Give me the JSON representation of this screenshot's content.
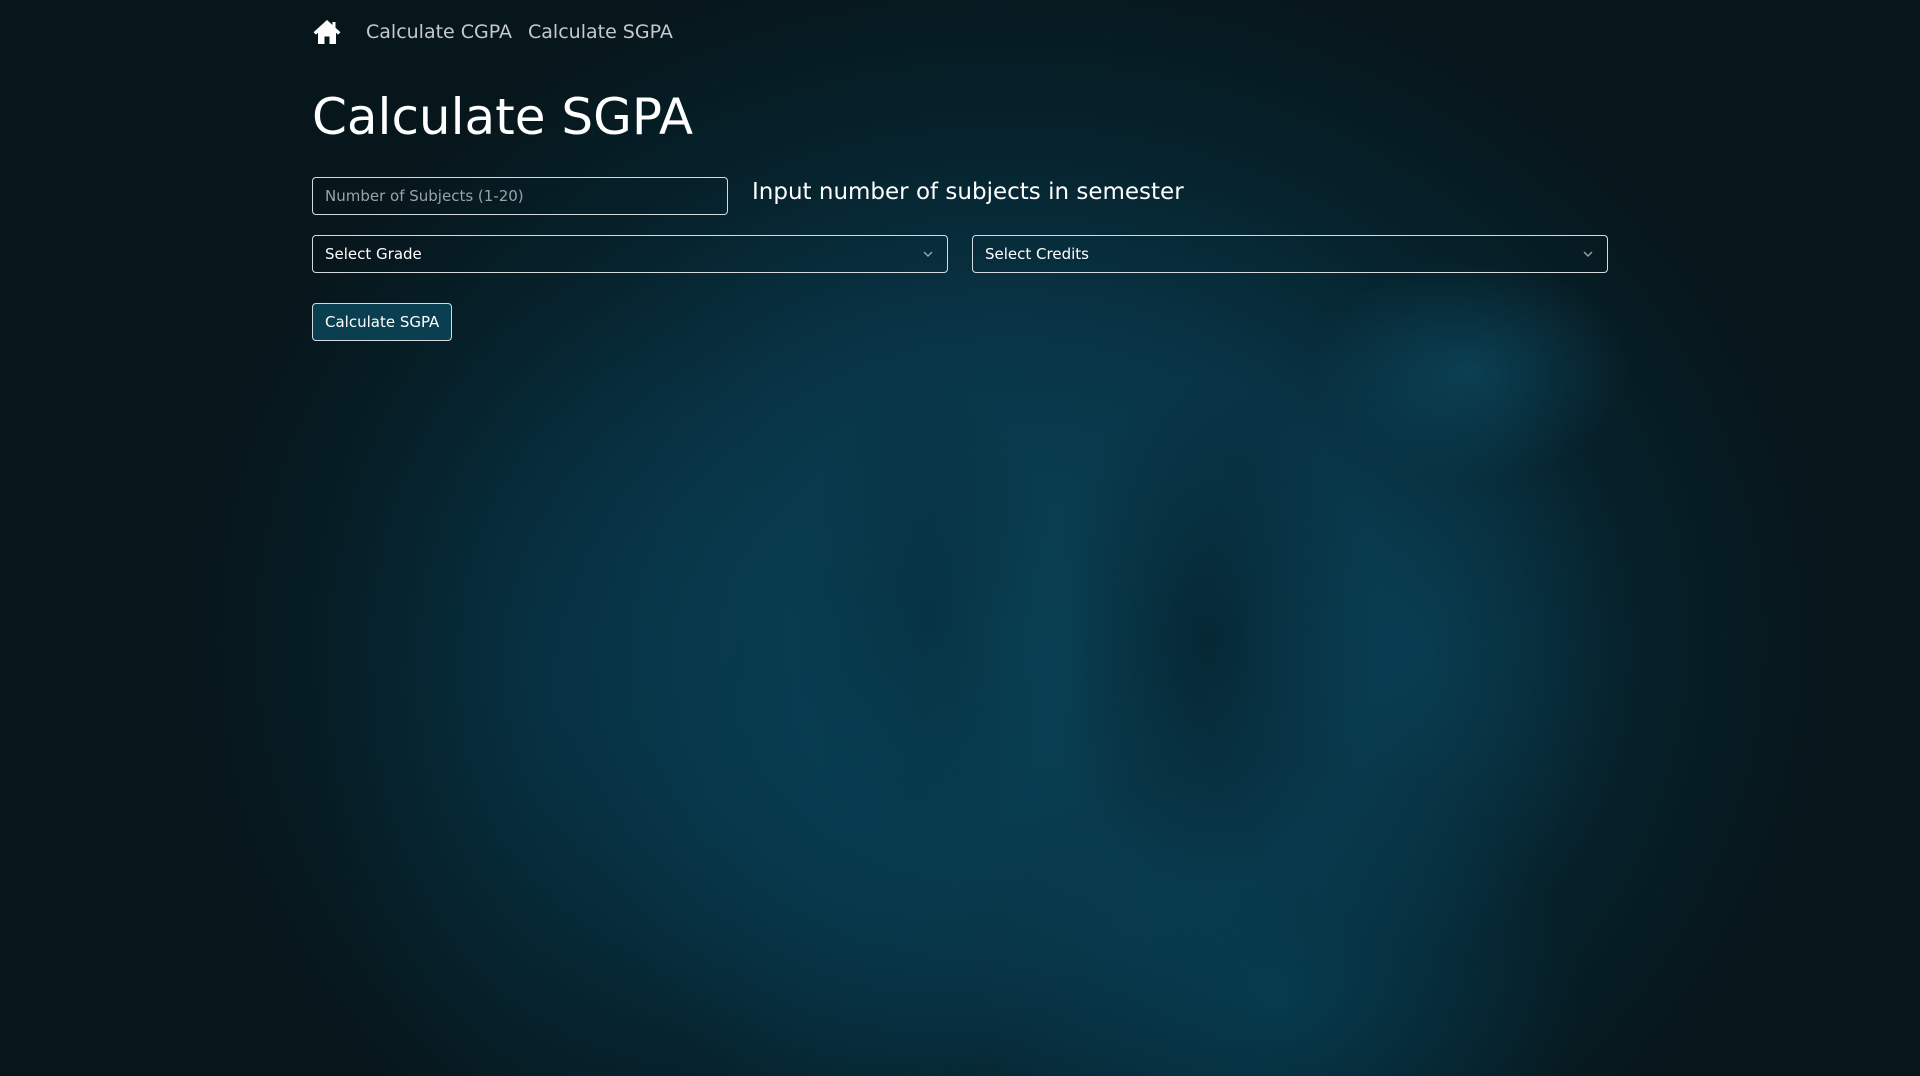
{
  "nav": {
    "home_icon": "home-icon",
    "links": [
      {
        "label": "Calculate CGPA"
      },
      {
        "label": "Calculate SGPA"
      }
    ]
  },
  "page": {
    "title": "Calculate SGPA"
  },
  "form": {
    "subjects_input": {
      "value": "",
      "placeholder": "Number of Subjects (1-20)"
    },
    "subjects_hint": "Input number of subjects in semester",
    "grade_select": {
      "selected": "Select Grade",
      "icon": "chevron-down-icon"
    },
    "credits_select": {
      "selected": "Select Credits",
      "icon": "chevron-down-icon"
    },
    "submit_label": "Calculate SGPA"
  },
  "colors": {
    "background": "#07191f",
    "background_glow": "#0a4458",
    "text": "#ffffff",
    "nav_text": "#c3c9cc",
    "border": "#d5dadc",
    "button_fill": "#0a3f52"
  }
}
